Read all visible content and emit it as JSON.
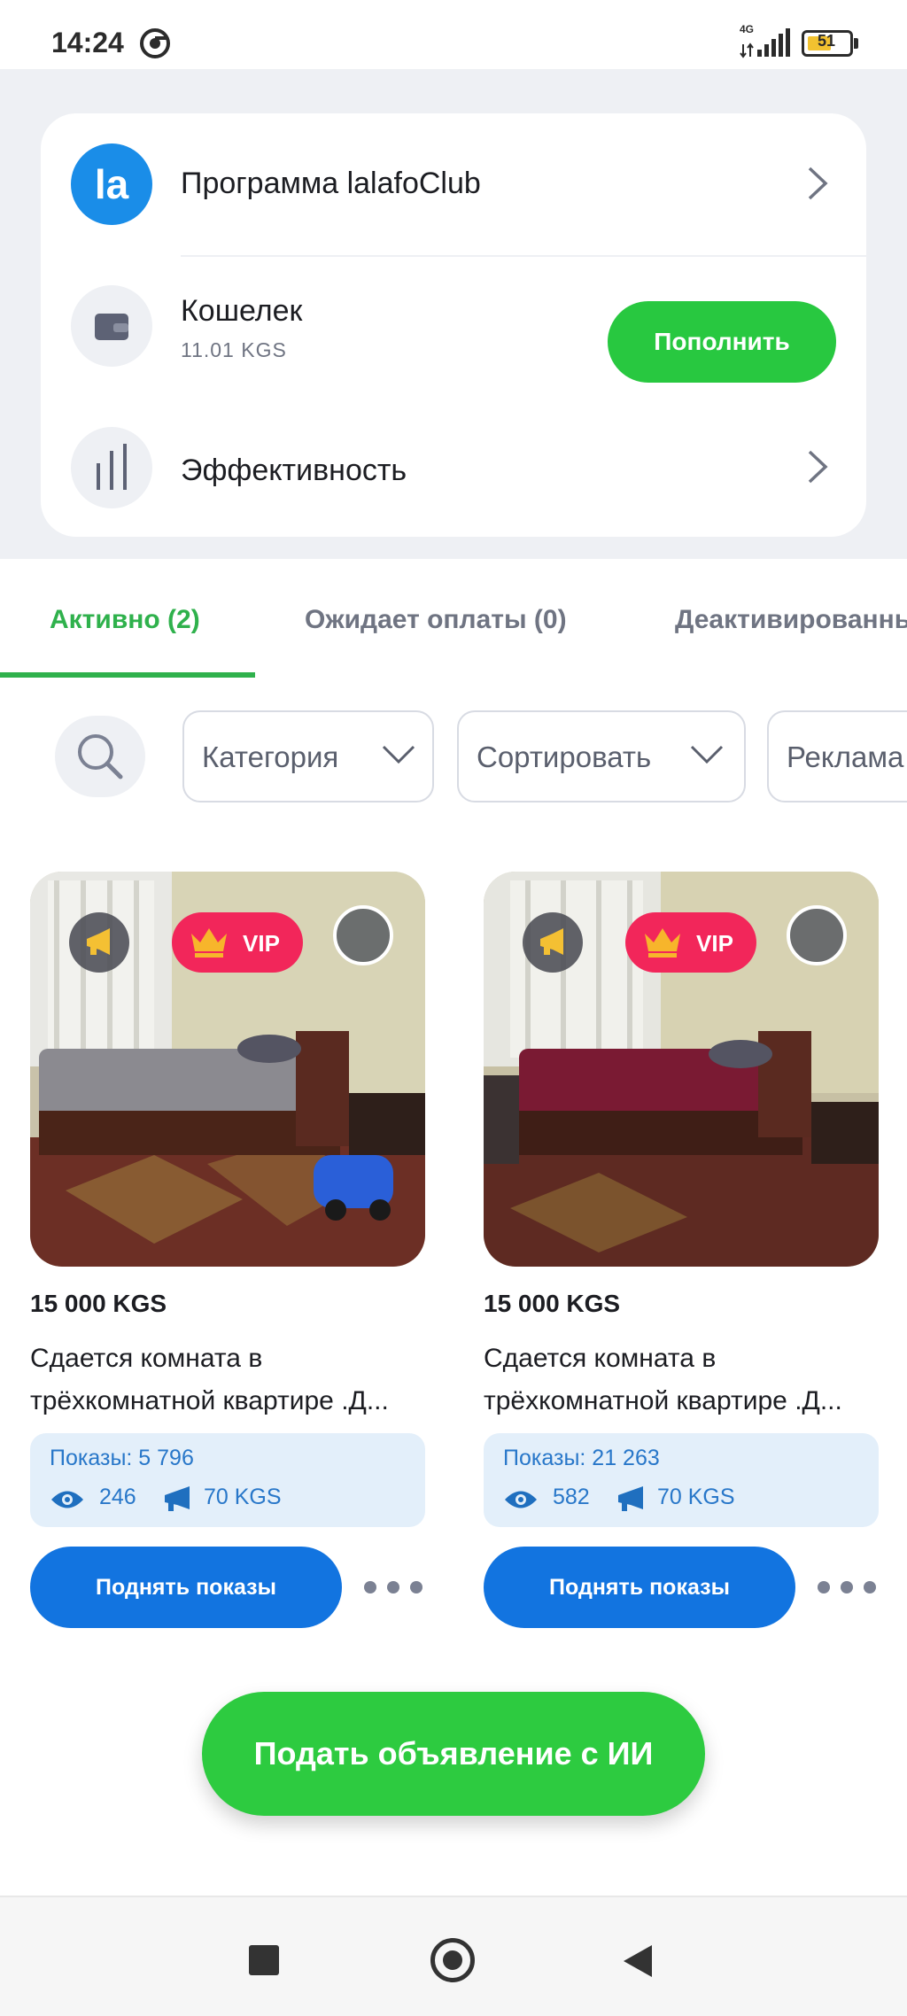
{
  "status_bar": {
    "time": "14:24",
    "network": "4G",
    "battery": "51"
  },
  "account": {
    "club": {
      "label": "Программа lalafoClub",
      "logo_text": "la"
    },
    "wallet": {
      "label": "Кошелек",
      "balance": "11.01 KGS",
      "topup_label": "Пополнить"
    },
    "efficiency": {
      "label": "Эффективность"
    }
  },
  "tabs": [
    {
      "label": "Активно (2)",
      "active": true
    },
    {
      "label": "Ожидает оплаты (0)",
      "active": false
    },
    {
      "label": "Деактивированные",
      "active": false
    }
  ],
  "filters": [
    {
      "label": "Категория"
    },
    {
      "label": "Сортировать"
    },
    {
      "label": "Реклама"
    }
  ],
  "listings": [
    {
      "badge": "VIP",
      "price": "15 000 KGS",
      "title": "Сдается комната в трёхкомнатной квартире .Д...",
      "views_label": "Показы: 5 796",
      "seen": "246",
      "spent": "70 KGS",
      "boost_label": "Поднять показы",
      "bedding_color": "#8b8a90"
    },
    {
      "badge": "VIP",
      "price": "15 000 KGS",
      "title": "Сдается комната в трёхкомнатной квартире .Д...",
      "views_label": "Показы: 21 263",
      "seen": "582",
      "spent": "70 KGS",
      "boost_label": "Поднять показы",
      "bedding_color": "#7a1a33"
    }
  ],
  "cta": {
    "label": "Подать объявление с ИИ"
  },
  "colors": {
    "accent_green": "#28c840",
    "tab_active": "#2fb14c",
    "primary_blue": "#1274e0",
    "vip_red": "#f2265a",
    "stats_text": "#2877c9"
  }
}
